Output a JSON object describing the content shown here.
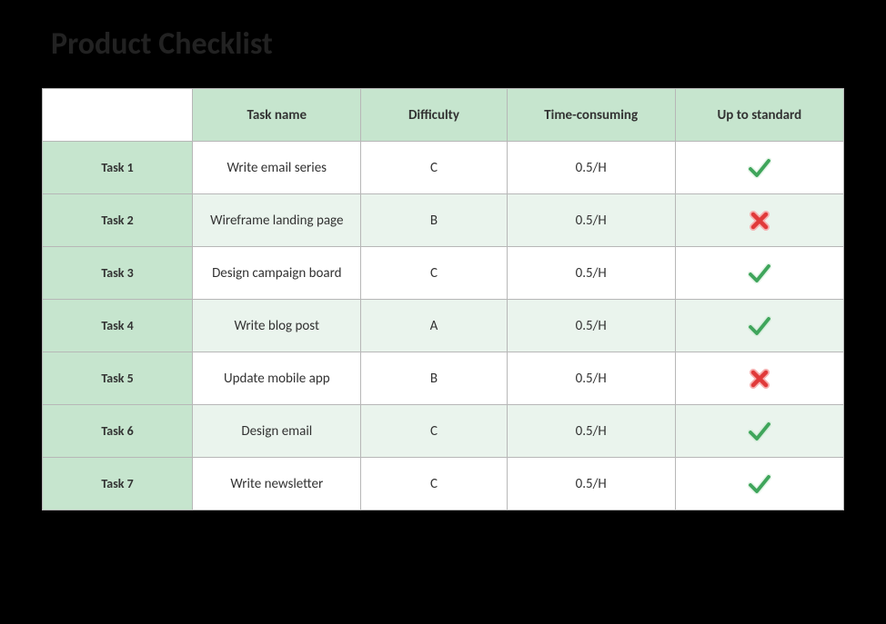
{
  "title": "Product Checklist",
  "columns": {
    "task_name": "Task name",
    "difficulty": "Difficulty",
    "time": "Time-consuming",
    "standard": "Up to standard"
  },
  "rows": [
    {
      "label": "Task 1",
      "name": "Write email series",
      "difficulty": "C",
      "time": "0.5/H",
      "standard": "check"
    },
    {
      "label": "Task 2",
      "name": "Wireframe landing page",
      "difficulty": "B",
      "time": "0.5/H",
      "standard": "cross"
    },
    {
      "label": "Task 3",
      "name": "Design campaign board",
      "difficulty": "C",
      "time": "0.5/H",
      "standard": "check"
    },
    {
      "label": "Task 4",
      "name": "Write blog post",
      "difficulty": "A",
      "time": "0.5/H",
      "standard": "check"
    },
    {
      "label": "Task 5",
      "name": "Update mobile app",
      "difficulty": "B",
      "time": "0.5/H",
      "standard": "cross"
    },
    {
      "label": "Task 6",
      "name": "Design email",
      "difficulty": "C",
      "time": "0.5/H",
      "standard": "check"
    },
    {
      "label": "Task 7",
      "name": "Write newsletter",
      "difficulty": "C",
      "time": "0.5/H",
      "standard": "check"
    }
  ],
  "icons": {
    "check": "check-icon",
    "cross": "cross-icon"
  },
  "colors": {
    "header_bg": "#c6e5ce",
    "alt_bg": "#eaf4ed",
    "check": "#3fa55b",
    "cross": "#e03a3a",
    "border": "#b7b7b7"
  }
}
